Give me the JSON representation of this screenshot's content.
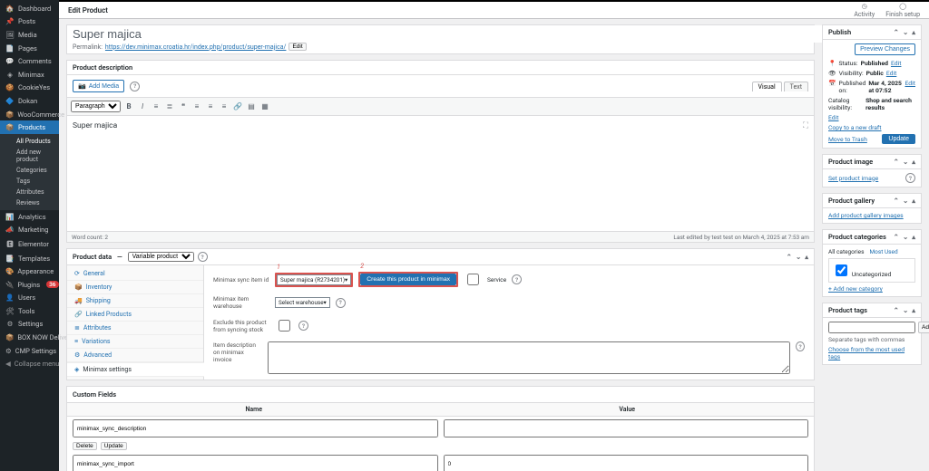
{
  "topbar": {
    "title": "Edit Product",
    "actions": {
      "activity": "Activity",
      "finish_setup": "Finish setup"
    }
  },
  "sidebar": {
    "items": [
      {
        "icon": "🏠",
        "label": "Dashboard"
      },
      {
        "icon": "📌",
        "label": "Posts"
      },
      {
        "icon": "🖼",
        "label": "Media"
      },
      {
        "icon": "📄",
        "label": "Pages"
      },
      {
        "icon": "💬",
        "label": "Comments"
      },
      {
        "icon": "◈",
        "label": "Minimax"
      },
      {
        "icon": "🍪",
        "label": "CookieYes"
      },
      {
        "icon": "🔷",
        "label": "Dokan"
      }
    ],
    "woocommerce": {
      "icon": "📦",
      "label": "WooCommerce"
    },
    "products": {
      "icon": "📦",
      "label": "Products"
    },
    "product_sub": [
      "All Products",
      "Add new product",
      "Categories",
      "Tags",
      "Attributes",
      "Reviews"
    ],
    "items2": [
      {
        "icon": "📊",
        "label": "Analytics"
      },
      {
        "icon": "📣",
        "label": "Marketing"
      },
      {
        "icon": "🅴",
        "label": "Elementor"
      },
      {
        "icon": "📑",
        "label": "Templates"
      },
      {
        "icon": "🎨",
        "label": "Appearance"
      },
      {
        "icon": "🔌",
        "label": "Plugins",
        "badge": "36"
      },
      {
        "icon": "👤",
        "label": "Users"
      },
      {
        "icon": "🛠",
        "label": "Tools"
      },
      {
        "icon": "⚙",
        "label": "Settings"
      },
      {
        "icon": "📦",
        "label": "BOX NOW Delivery"
      },
      {
        "icon": "⚙",
        "label": "CMP Settings"
      }
    ],
    "collapse": "Collapse menu"
  },
  "title": {
    "value": "Super majica",
    "permalink_label": "Permalink:",
    "permalink_url": "https://dev.minimax.croatia.hr/index.php/product/super-majica/",
    "edit_btn": "Edit"
  },
  "editor": {
    "panel_title": "Product description",
    "add_media": "Add Media",
    "formats_default": "Paragraph",
    "tabs": {
      "visual": "Visual",
      "text": "Text"
    },
    "body": "Super majica",
    "word_count_label": "Word count: 2",
    "last_edited": "Last edited by test test on March 4, 2025 at 7:53 am"
  },
  "pdata": {
    "label": "Product data",
    "type": "Variable product",
    "tabs": [
      {
        "i": "⟳",
        "l": "General"
      },
      {
        "i": "📦",
        "l": "Inventory"
      },
      {
        "i": "🚚",
        "l": "Shipping"
      },
      {
        "i": "🔗",
        "l": "Linked Products"
      },
      {
        "i": "≣",
        "l": "Attributes"
      },
      {
        "i": "≡",
        "l": "Variations"
      },
      {
        "i": "⚙",
        "l": "Advanced"
      },
      {
        "i": "◈",
        "l": "Minimax settings"
      }
    ],
    "f_sync_item": {
      "label": "Minimax sync item id",
      "dropdown": "Super majica (R2734201)▾",
      "callout": "1"
    },
    "f_create_btn": {
      "label": "Create this product in minimax",
      "callout": "2"
    },
    "f_service": "Service",
    "f_warehouse": {
      "label": "Minimax item warehouse",
      "dropdown": "Select warehouse▾"
    },
    "f_exclude": "Exclude this product from syncing stock",
    "f_desc": "Item description on minimax invoice"
  },
  "custom_fields": {
    "title": "Custom Fields",
    "cols": {
      "name": "Name",
      "value": "Value"
    },
    "rows": [
      {
        "name": "minimax_sync_description",
        "value": ""
      },
      {
        "name": "minimax_sync_import",
        "value": "0"
      }
    ],
    "btns": {
      "delete": "Delete",
      "update": "Update"
    }
  },
  "publish": {
    "title": "Publish",
    "preview": "Preview Changes",
    "status_label": "Status:",
    "status_value": "Published",
    "edit": "Edit",
    "vis_label": "Visibility:",
    "vis_value": "Public",
    "pub_label": "Published on:",
    "pub_value": "Mar 4, 2025 at 07:52",
    "cat_label": "Catalog visibility:",
    "cat_value": "Shop and search results",
    "copy_draft": "Copy to a new draft",
    "trash": "Move to Trash",
    "update": "Update"
  },
  "rboxes": {
    "image": {
      "title": "Product image",
      "link": "Set product image"
    },
    "gallery": {
      "title": "Product gallery",
      "link": "Add product gallery images"
    },
    "categories": {
      "title": "Product categories",
      "all": "All categories",
      "most": "Most Used",
      "item": "Uncategorized",
      "add": "+ Add new category"
    },
    "tags": {
      "title": "Product tags",
      "add": "Add",
      "hint": "Separate tags with commas",
      "choose": "Choose from the most used tags"
    }
  }
}
